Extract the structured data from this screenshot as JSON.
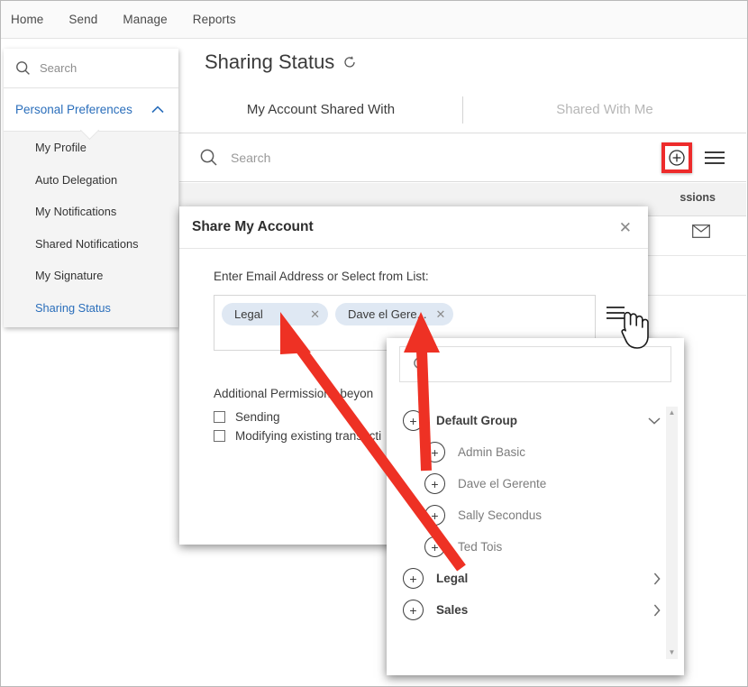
{
  "topnav": {
    "items": [
      {
        "label": "Home"
      },
      {
        "label": "Send"
      },
      {
        "label": "Manage"
      },
      {
        "label": "Reports"
      }
    ]
  },
  "sidebar": {
    "search_placeholder": "Search",
    "group": {
      "label": "Personal Preferences",
      "expanded": true
    },
    "items": [
      {
        "label": "My Profile",
        "active": false
      },
      {
        "label": "Auto Delegation",
        "active": false
      },
      {
        "label": "My Notifications",
        "active": false
      },
      {
        "label": "Shared Notifications",
        "active": false
      },
      {
        "label": "My Signature",
        "active": false
      },
      {
        "label": "Sharing Status",
        "active": true
      }
    ]
  },
  "main": {
    "page_title": "Sharing Status",
    "tabs": [
      {
        "label": "My Account Shared With",
        "active": true
      },
      {
        "label": "Shared With Me",
        "active": false
      }
    ],
    "search_placeholder": "Search",
    "table_header_partial": "ssions"
  },
  "dialog": {
    "title": "Share My Account",
    "close_label": "✕",
    "field_label": "Enter Email Address or Select from List:",
    "chips": [
      {
        "label": "Legal",
        "remove": "✕"
      },
      {
        "label": "Dave el Gere...",
        "remove": "✕"
      }
    ],
    "permissions_title": "Additional Permissions beyon",
    "permissions": [
      {
        "label": "Sending",
        "checked": false
      },
      {
        "label": "Modifying existing transacti",
        "checked": false
      }
    ]
  },
  "picker": {
    "search_placeholder": "",
    "rows": [
      {
        "label": "Default Group",
        "type": "group",
        "chevron": "∨",
        "indent": false
      },
      {
        "label": "Admin Basic",
        "type": "user",
        "chevron": "",
        "indent": true
      },
      {
        "label": "Dave el Gerente",
        "type": "user",
        "chevron": "",
        "indent": true
      },
      {
        "label": "Sally Secondus",
        "type": "user",
        "chevron": "",
        "indent": true
      },
      {
        "label": "Ted Tois",
        "type": "user",
        "chevron": "",
        "indent": true
      },
      {
        "label": "Legal",
        "type": "group",
        "chevron": "›",
        "indent": false
      },
      {
        "label": "Sales",
        "type": "group",
        "chevron": "›",
        "indent": false
      }
    ],
    "scroll_up": "▲",
    "scroll_down": "▼"
  },
  "annotations": {
    "highlight_color": "#ed2b2b",
    "arrow_color": "#ee3124",
    "plus_button_label": "⊕"
  }
}
